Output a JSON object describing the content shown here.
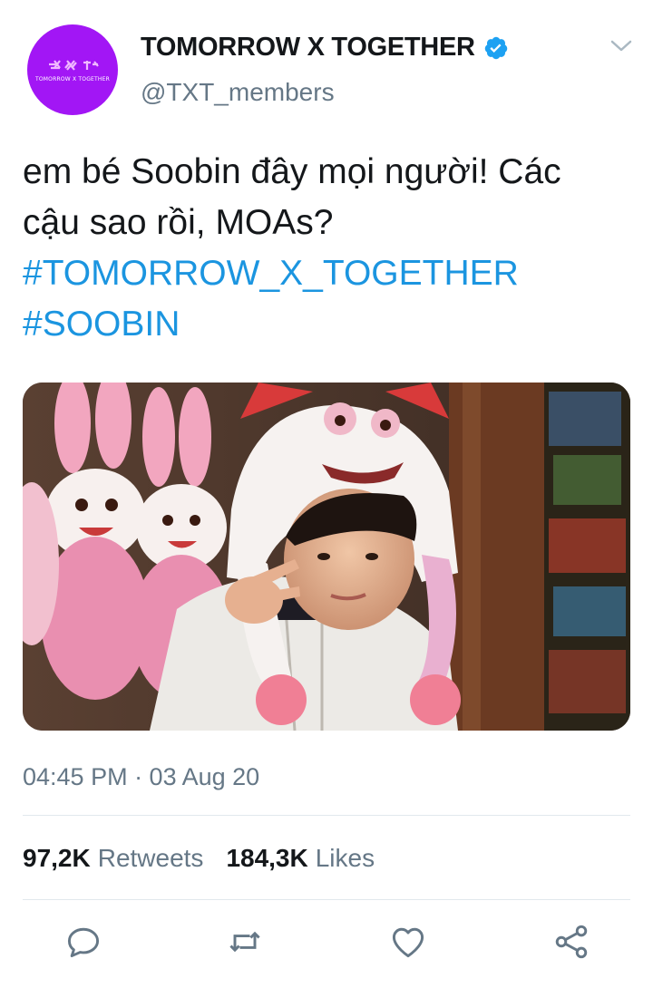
{
  "author": {
    "display_name": "TOMORROW X TOGETHER",
    "handle": "@TXT_members",
    "avatar_text": "TOMORROW X TOGETHER",
    "avatar_color": "#a216f5",
    "verified": true
  },
  "tweet": {
    "text_lines": [
      "em bé Soobin đây mọi người! Các",
      "cậu sao rồi, MOAs?"
    ],
    "hashtags": [
      "#TOMORROW_X_TOGETHER",
      "#SOOBIN"
    ],
    "timestamp": "04:45 PM · 03 Aug 20"
  },
  "stats": {
    "retweets_count": "97,2K",
    "retweets_label": "Retweets",
    "likes_count": "184,3K",
    "likes_label": "Likes"
  },
  "actions": [
    "reply-icon",
    "retweet-icon",
    "like-icon",
    "share-icon"
  ],
  "colors": {
    "link": "#1b95e0",
    "secondary_text": "#657786",
    "primary_text": "#14171a",
    "verified_badge": "#1da1f2",
    "divider": "#e1e8ed"
  }
}
